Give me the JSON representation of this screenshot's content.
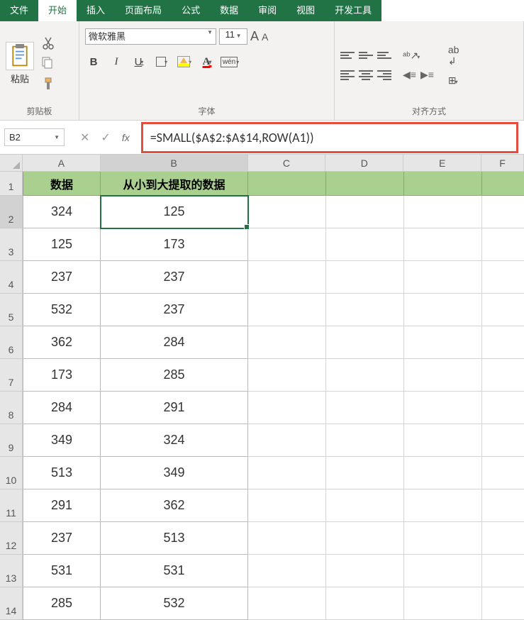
{
  "menu": {
    "file": "文件",
    "home": "开始",
    "insert": "插入",
    "layout": "页面布局",
    "formula": "公式",
    "data": "数据",
    "review": "审阅",
    "view": "视图",
    "developer": "开发工具"
  },
  "ribbon": {
    "clipboard_label": "剪贴板",
    "paste_label": "粘贴",
    "font_label": "字体",
    "font_name": "微软雅黑",
    "font_size": "11",
    "align_label": "对齐方式"
  },
  "cell_ref": "B2",
  "formula": "=SMALL($A$2:$A$14,ROW(A1))",
  "columns": [
    "A",
    "B",
    "C",
    "D",
    "E",
    "F"
  ],
  "row_numbers": [
    1,
    2,
    3,
    4,
    5,
    6,
    7,
    8,
    9,
    10,
    11,
    12,
    13,
    14
  ],
  "headers": {
    "A": "数据",
    "B": "从小到大提取的数据"
  },
  "table": [
    {
      "A": "324",
      "B": "125"
    },
    {
      "A": "125",
      "B": "173"
    },
    {
      "A": "237",
      "B": "237"
    },
    {
      "A": "532",
      "B": "237"
    },
    {
      "A": "362",
      "B": "284"
    },
    {
      "A": "173",
      "B": "285"
    },
    {
      "A": "284",
      "B": "291"
    },
    {
      "A": "349",
      "B": "324"
    },
    {
      "A": "513",
      "B": "349"
    },
    {
      "A": "291",
      "B": "362"
    },
    {
      "A": "237",
      "B": "513"
    },
    {
      "A": "531",
      "B": "531"
    },
    {
      "A": "285",
      "B": "532"
    }
  ],
  "selected_cell": "B2"
}
